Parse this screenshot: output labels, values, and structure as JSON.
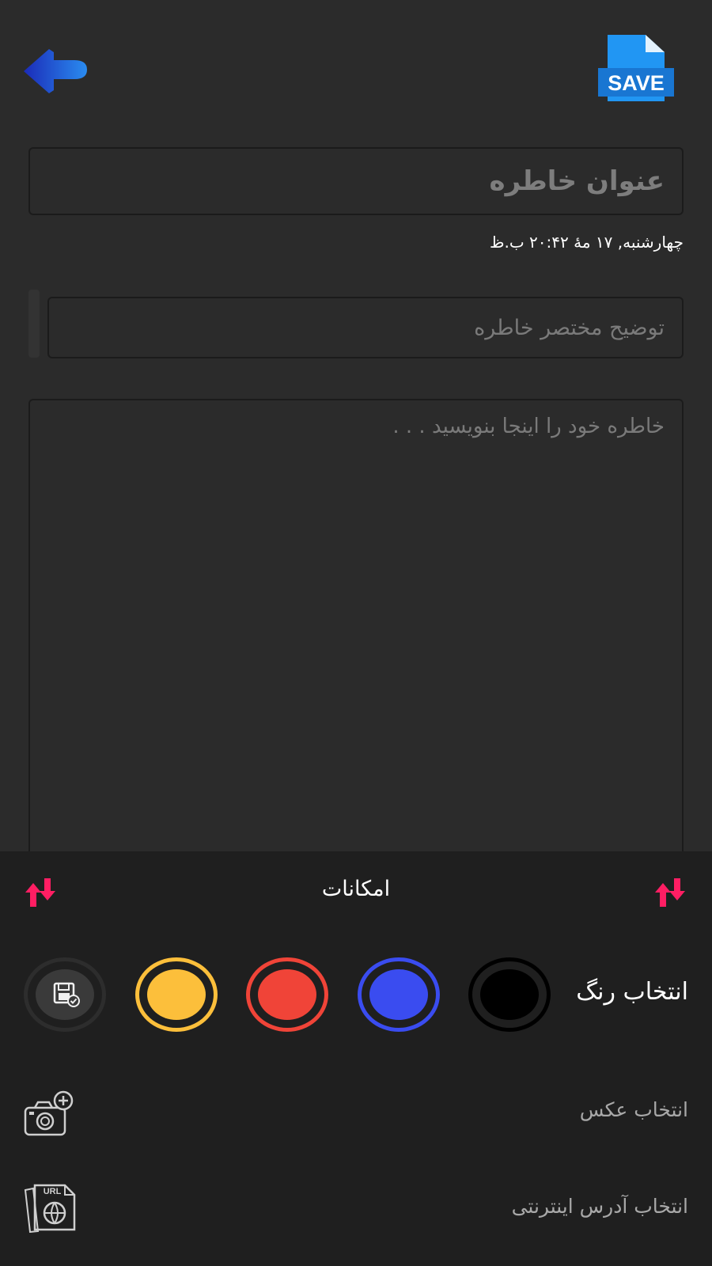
{
  "header": {
    "back_icon": "back-arrow-icon",
    "save_label": "SAVE",
    "save_color": "#1e88e5"
  },
  "form": {
    "title_placeholder": "عنوان خاطره",
    "date_text": "چهارشنبه, ۱۷ مهٔ ۲۰:۴۲ ب.ظ",
    "description_placeholder": "توضیح مختصر خاطره",
    "body_placeholder": "خاطره خود را اینجا بنویسید . . ."
  },
  "sheet": {
    "title": "امکانات",
    "color_label": "انتخاب رنگ",
    "colors": [
      "#000000",
      "#3a4cf0",
      "#f04438",
      "#fcbf3b"
    ],
    "photo_label": "انتخاب عکس",
    "url_label": "انتخاب آدرس اینترنتی",
    "url_badge": "URL",
    "accent_color": "#ff1e63"
  }
}
